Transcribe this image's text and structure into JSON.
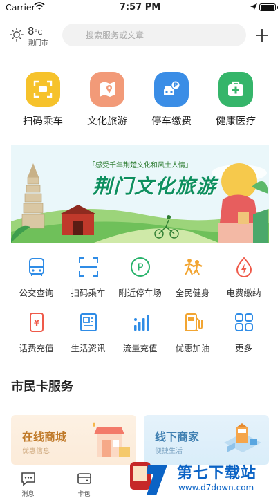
{
  "status_bar": {
    "carrier": "Carrier",
    "time": "7:57 PM",
    "battery_level": 1.0
  },
  "weather": {
    "temperature": "8",
    "unit": "°C",
    "city": "荆门市"
  },
  "search": {
    "placeholder": "搜索服务或文章"
  },
  "top_services": [
    {
      "label": "扫码乘车",
      "icon": "scan-icon",
      "color": "#f6c22b"
    },
    {
      "label": "文化旅游",
      "icon": "map-icon",
      "color": "#f29a78"
    },
    {
      "label": "停车缴费",
      "icon": "car-parking-icon",
      "color": "#3a8de6"
    },
    {
      "label": "健康医疗",
      "icon": "medical-kit-icon",
      "color": "#35b56a"
    }
  ],
  "banner": {
    "tagline": "「感受千年荆楚文化和风土人情」",
    "title": "荆门文化旅游"
  },
  "grid_services": [
    {
      "label": "公交查询",
      "icon": "bus-icon"
    },
    {
      "label": "扫码乘车",
      "icon": "scan-icon"
    },
    {
      "label": "附近停车场",
      "icon": "parking-icon"
    },
    {
      "label": "全民健身",
      "icon": "fitness-icon"
    },
    {
      "label": "电费缴纳",
      "icon": "electricity-icon"
    },
    {
      "label": "话费充值",
      "icon": "phone-bill-icon"
    },
    {
      "label": "生活资讯",
      "icon": "news-icon"
    },
    {
      "label": "流量充值",
      "icon": "data-signal-icon"
    },
    {
      "label": "优惠加油",
      "icon": "fuel-icon"
    },
    {
      "label": "更多",
      "icon": "more-grid-icon"
    }
  ],
  "citizen_card": {
    "section_title": "市民卡服务",
    "cards": [
      {
        "title": "在线商城",
        "subtitle": "优惠信息"
      },
      {
        "title": "线下商家",
        "subtitle": "便捷生活"
      }
    ]
  },
  "tabbar": [
    {
      "label": "消息",
      "icon": "message-icon"
    },
    {
      "label": "卡包",
      "icon": "wallet-icon"
    }
  ],
  "watermark": {
    "site": "第七下载站",
    "url": "www.d7down.com"
  },
  "colors": {
    "accent_blue": "#3a8de6",
    "accent_green": "#35b56a",
    "accent_yellow": "#f6c22b",
    "accent_orange": "#f29a78"
  }
}
